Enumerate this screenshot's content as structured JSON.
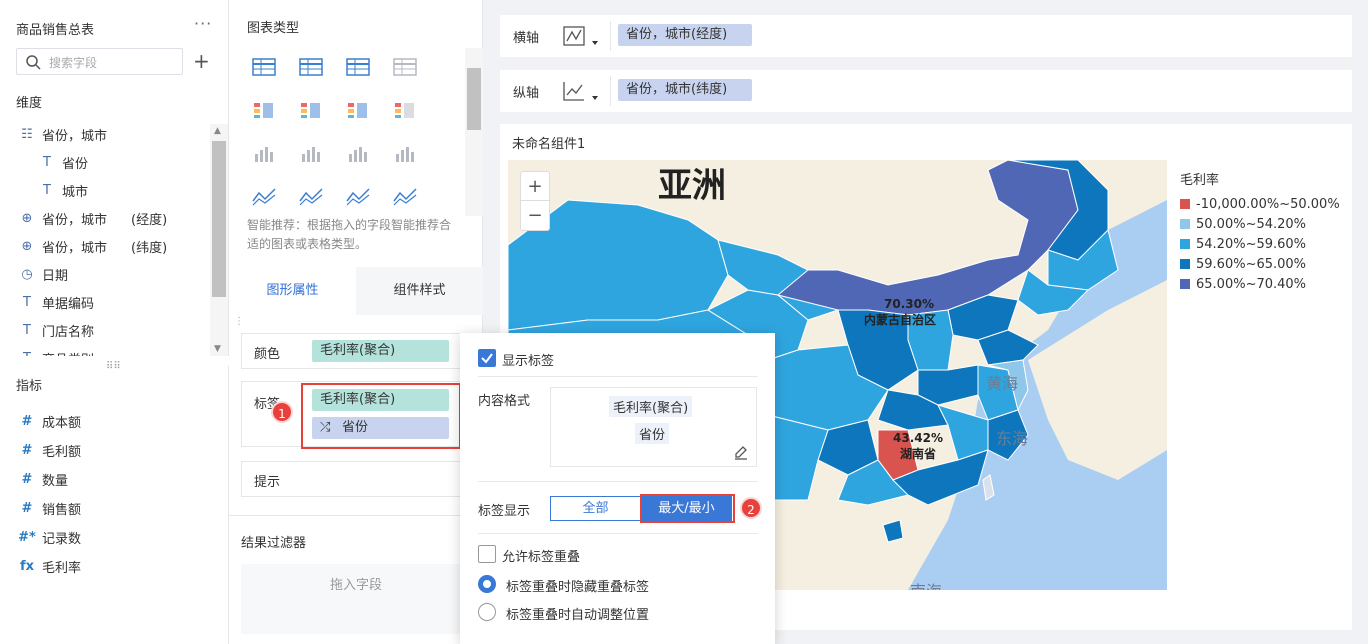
{
  "left_panel": {
    "title": "商品销售总表",
    "menu": "···",
    "search_placeholder": "搜索字段",
    "add": "+",
    "dimensions_title": "维度",
    "dimensions": [
      {
        "icon": "hierarchy-icon",
        "label": "省份，城市",
        "suffix": ""
      },
      {
        "icon": "text-field-icon",
        "label": "省份",
        "suffix": ""
      },
      {
        "icon": "text-field-icon",
        "label": "城市",
        "suffix": ""
      },
      {
        "icon": "globe-icon",
        "label": "省份，城市",
        "suffix": "(经度)"
      },
      {
        "icon": "globe-icon",
        "label": "省份，城市",
        "suffix": "(纬度)"
      },
      {
        "icon": "clock-icon",
        "label": "日期",
        "suffix": ""
      },
      {
        "icon": "text-field-icon",
        "label": "单据编码",
        "suffix": ""
      },
      {
        "icon": "text-field-icon",
        "label": "门店名称",
        "suffix": ""
      },
      {
        "icon": "text-field-icon",
        "label": "商品类别",
        "suffix": ""
      }
    ],
    "metrics_title": "指标",
    "metrics": [
      {
        "icon": "#",
        "label": "成本额"
      },
      {
        "icon": "#",
        "label": "毛利额"
      },
      {
        "icon": "#",
        "label": "数量"
      },
      {
        "icon": "#",
        "label": "销售额"
      },
      {
        "icon": "#*",
        "label": "记录数"
      },
      {
        "icon": "fx",
        "label": "毛利率"
      }
    ]
  },
  "middle_panel": {
    "chart_type_title": "图表类型",
    "smart_hint": "智能推荐：根据拖入的字段智能推荐合适的图表或表格类型。",
    "tab_shape": "图形属性",
    "tab_style": "组件样式",
    "color_label": "颜色",
    "color_field": "毛利率(聚合)",
    "label_label": "标签",
    "label_field1": "毛利率(聚合)",
    "label_field2": "省份",
    "tooltip_label": "提示",
    "filter_title": "结果过滤器",
    "filter_placeholder": "拖入字段",
    "badge1": "1"
  },
  "axes": {
    "x_label": "横轴",
    "x_field": "省份，城市(经度)",
    "y_label": "纵轴",
    "y_field": "省份，城市(纬度)"
  },
  "chart": {
    "title": "未命名组件1",
    "zoom_in": "+",
    "zoom_out": "−",
    "map_labels": {
      "asia": "亚洲",
      "yellow_sea": "黄海",
      "east_sea": "东海",
      "south_sea": "南海"
    },
    "data_labels": [
      {
        "value": "70.30%",
        "name": "内蒙古自治区"
      },
      {
        "value": "43.42%",
        "name": "湖南省"
      }
    ],
    "legend_title": "毛利率",
    "legend": [
      {
        "label": "-10,000.00%~50.00%",
        "color": "#d9534f"
      },
      {
        "label": "50.00%~54.20%",
        "color": "#8ec7ea"
      },
      {
        "label": "54.20%~59.60%",
        "color": "#2fa5df"
      },
      {
        "label": "59.60%~65.00%",
        "color": "#0e76bc"
      },
      {
        "label": "65.00%~70.40%",
        "color": "#4f67b5"
      }
    ]
  },
  "popup": {
    "show_label": "显示标签",
    "content_format": "内容格式",
    "content_field1": "毛利率(聚合)",
    "content_field2": "省份",
    "label_display": "标签显示",
    "opt_all": "全部",
    "opt_maxmin": "最大/最小",
    "allow_overlap": "允许标签重叠",
    "radio1": "标签重叠时隐藏重叠标签",
    "radio2": "标签重叠时自动调整位置",
    "badge2": "2"
  }
}
